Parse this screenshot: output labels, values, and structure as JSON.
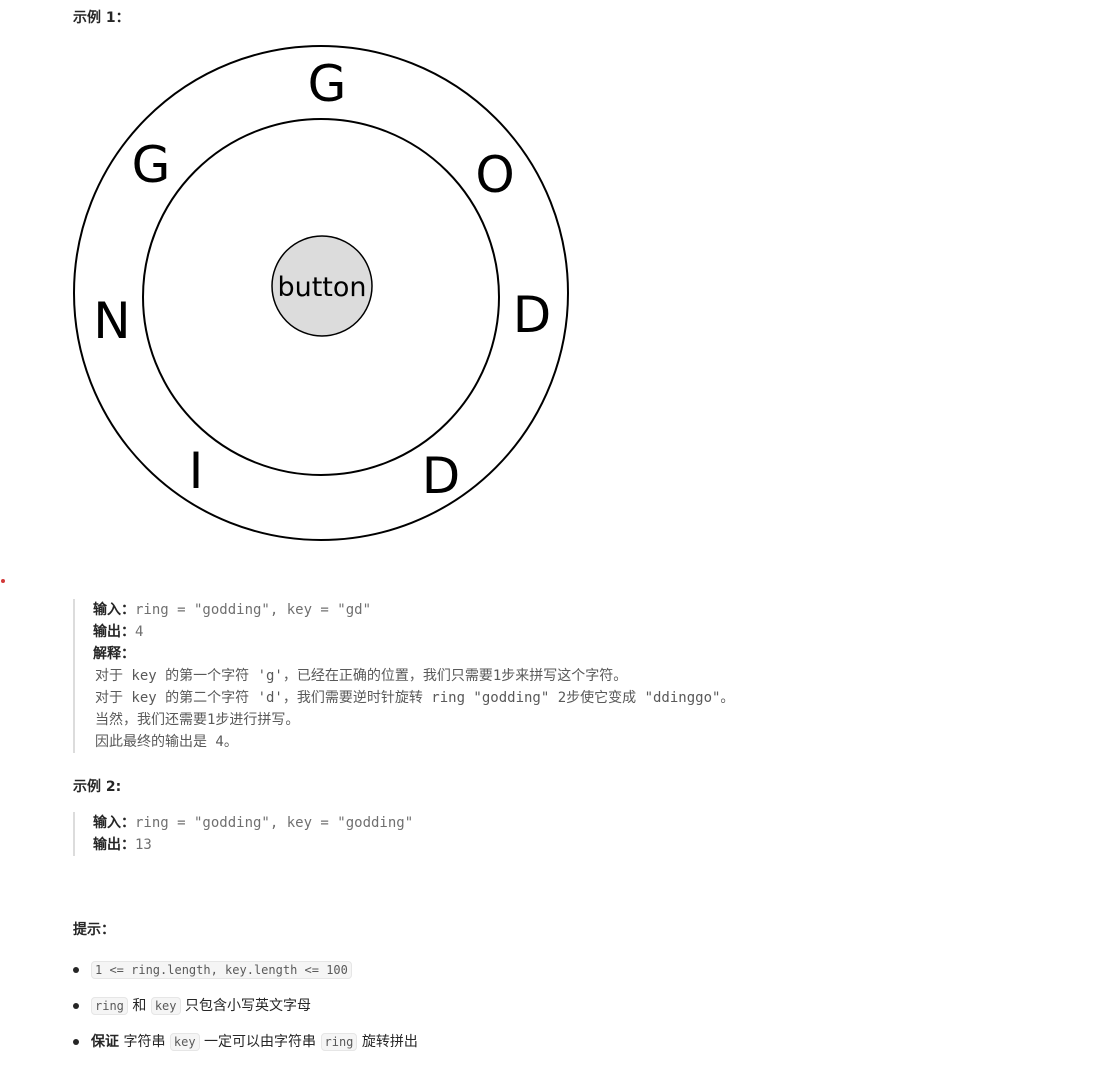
{
  "example1": {
    "heading": "示例 1：",
    "diagram": {
      "letters": [
        "G",
        "O",
        "D",
        "D",
        "I",
        "N",
        "G"
      ],
      "center_label": "button"
    },
    "input_label": "输入：",
    "input_value": "ring = \"godding\", key = \"gd\"",
    "output_label": "输出：",
    "output_value": "4",
    "explain_label": "解释：",
    "explain_lines": [
      "对于 key 的第一个字符 'g'，已经在正确的位置，我们只需要1步来拼写这个字符。",
      "对于 key 的第二个字符 'd'，我们需要逆时针旋转 ring \"godding\" 2步使它变成 \"ddinggo\"。",
      "当然，我们还需要1步进行拼写。",
      "因此最终的输出是 4。"
    ]
  },
  "example2": {
    "heading": "示例 2:",
    "input_label": "输入：",
    "input_value": "ring = \"godding\", key = \"godding\"",
    "output_label": "输出：",
    "output_value": "13"
  },
  "hints": {
    "heading": "提示：",
    "item1_code": "1 <= ring.length, key.length <= 100",
    "item2_code_a": "ring",
    "item2_text_a": "和",
    "item2_code_b": "key",
    "item2_text_b": "只包含小写英文字母",
    "item3_bold": "保证",
    "item3_text_a": "字符串",
    "item3_code_a": "key",
    "item3_text_b": "一定可以由字符串",
    "item3_code_b": "ring",
    "item3_text_c": "旋转拼出"
  }
}
